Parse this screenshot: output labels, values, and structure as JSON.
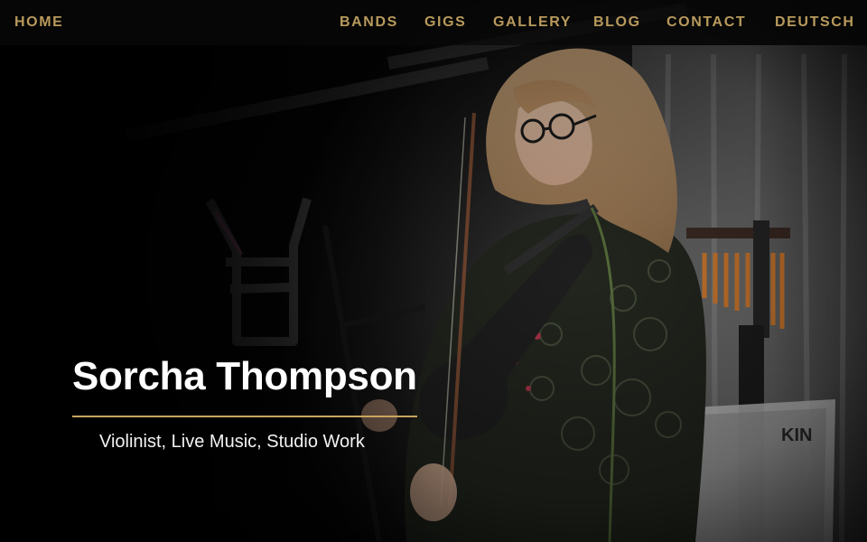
{
  "nav": {
    "home": "HOME",
    "items": [
      "BANDS",
      "GIGS",
      "GALLERY",
      "BLOG",
      "CONTACT",
      "DEUTSCH"
    ],
    "color": "#b89a5c"
  },
  "hero": {
    "title": "Sorcha Thompson",
    "subtitle": "Violinist, Live Music, Studio Work",
    "rule_color": "#c9a55f"
  },
  "background_photo": {
    "stand_label": "KIN"
  }
}
